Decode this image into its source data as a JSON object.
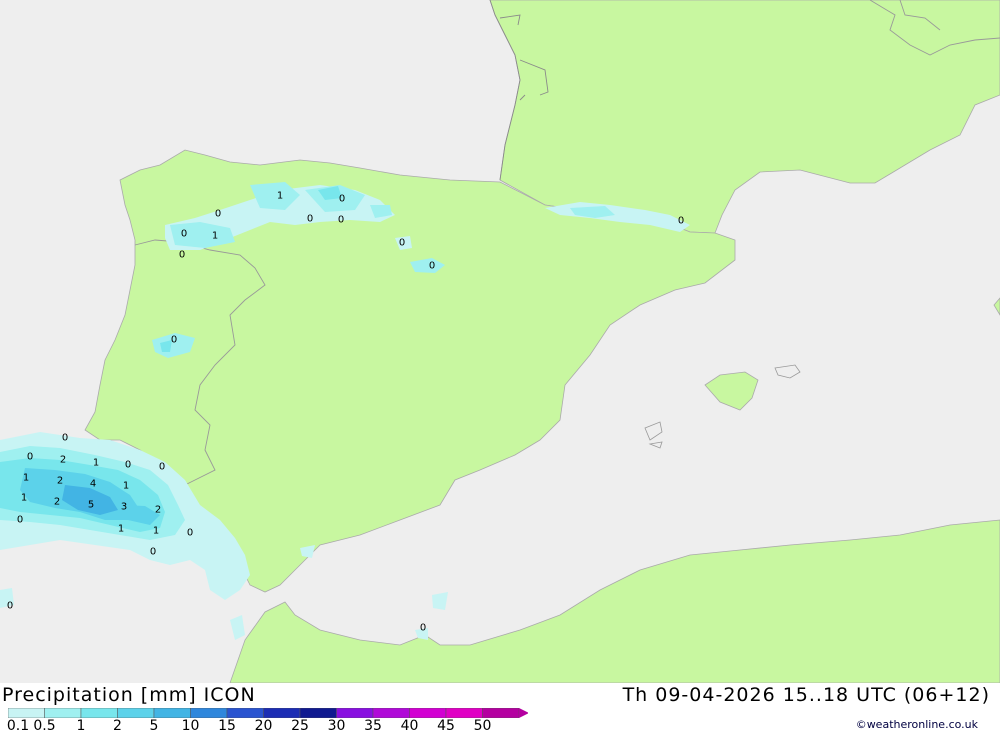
{
  "header": {
    "product": "Precipitation [mm] ICON",
    "valid_time": "Th 09-04-2026 15..18 UTC (06+12)"
  },
  "legend": {
    "levels": [
      "0.1",
      "0.5",
      "1",
      "2",
      "5",
      "10",
      "15",
      "20",
      "25",
      "30",
      "35",
      "40",
      "45",
      "50"
    ],
    "colors": [
      "#c8f4f4",
      "#9ff0f0",
      "#78e6ec",
      "#5cd2ea",
      "#42b4e4",
      "#2f87dc",
      "#2a54d0",
      "#1c2db4",
      "#101a90",
      "#8810e0",
      "#b00ad8",
      "#d200d2",
      "#e000c4",
      "#b400a0"
    ]
  },
  "colors": {
    "sea": "#eeeeee",
    "land": "#c8f7a0",
    "border": "#999999"
  },
  "map_labels": [
    {
      "id": "v1",
      "text": "1"
    },
    {
      "id": "v2",
      "text": "0"
    },
    {
      "id": "v3",
      "text": "0"
    },
    {
      "id": "v4",
      "text": "0"
    },
    {
      "id": "v5",
      "text": "0"
    },
    {
      "id": "v6",
      "text": "0"
    },
    {
      "id": "v7",
      "text": "1"
    },
    {
      "id": "v8",
      "text": "0"
    },
    {
      "id": "v9",
      "text": "0"
    },
    {
      "id": "v10",
      "text": "0"
    },
    {
      "id": "v11",
      "text": "0"
    },
    {
      "id": "v12",
      "text": "0"
    },
    {
      "id": "v13",
      "text": "0"
    },
    {
      "id": "v14",
      "text": "0"
    },
    {
      "id": "v15",
      "text": "2"
    },
    {
      "id": "v16",
      "text": "1"
    },
    {
      "id": "v17",
      "text": "0"
    },
    {
      "id": "v18",
      "text": "0"
    },
    {
      "id": "v19",
      "text": "1"
    },
    {
      "id": "v20",
      "text": "2"
    },
    {
      "id": "v21",
      "text": "4"
    },
    {
      "id": "v22",
      "text": "1"
    },
    {
      "id": "v23",
      "text": "1"
    },
    {
      "id": "v24",
      "text": "2"
    },
    {
      "id": "v25",
      "text": "5"
    },
    {
      "id": "v26",
      "text": "3"
    },
    {
      "id": "v27",
      "text": "2"
    },
    {
      "id": "v28",
      "text": "0"
    },
    {
      "id": "v29",
      "text": "1"
    },
    {
      "id": "v30",
      "text": "1"
    },
    {
      "id": "v31",
      "text": "0"
    },
    {
      "id": "v32",
      "text": "0"
    },
    {
      "id": "v33",
      "text": "0"
    },
    {
      "id": "v34",
      "text": "0"
    }
  ],
  "credit": "©weatheronline.co.uk"
}
